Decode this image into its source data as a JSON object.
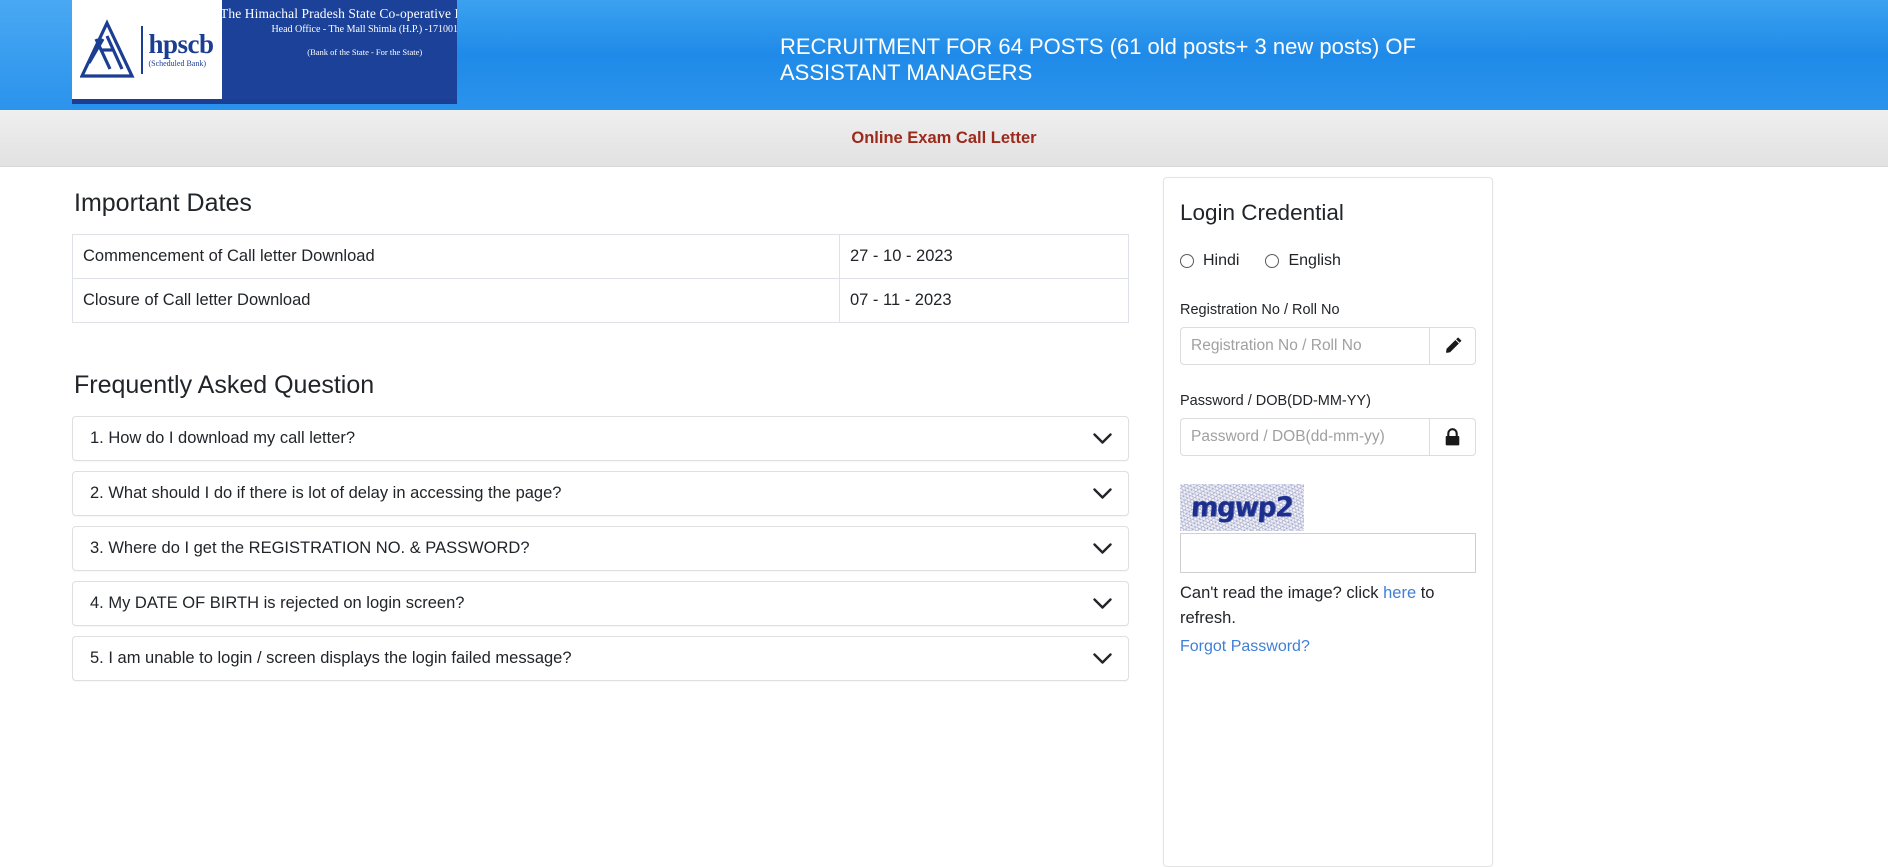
{
  "header": {
    "logo": {
      "brand_short": "hpscb",
      "brand_sub": "(Scheduled Bank)",
      "bank_name": "The Himachal Pradesh State Co-operative Bank Ltd.",
      "office_line": "Head Office - The Mall Shimla (H.P.) -171001",
      "tagline": "(Bank of the State - For the State)"
    },
    "title": "RECRUITMENT FOR 64 POSTS (61 old posts+ 3 new posts) OF ASSISTANT MANAGERS",
    "subheader": "Online Exam Call Letter",
    "subheader_color": "#9c2a1c",
    "banner_color": "#2a93ec",
    "logo_blue": "#1b4298"
  },
  "important_dates": {
    "heading": "Important Dates",
    "rows": [
      {
        "label": "Commencement of Call letter Download",
        "value": "27 - 10 - 2023"
      },
      {
        "label": "Closure of Call letter Download",
        "value": "07 - 11 - 2023"
      }
    ]
  },
  "faq": {
    "heading": "Frequently Asked Question",
    "items": [
      {
        "question": "1. How do I download my call letter?",
        "icon": "chevron-down-icon"
      },
      {
        "question": "2. What should I do if there is lot of delay in accessing the page?",
        "icon": "chevron-down-icon"
      },
      {
        "question": "3. Where do I get the REGISTRATION NO. & PASSWORD?",
        "icon": "chevron-down-icon"
      },
      {
        "question": "4. My DATE OF BIRTH is rejected on login screen?",
        "icon": "chevron-down-icon"
      },
      {
        "question": "5. I am unable to login / screen displays the login failed message?",
        "icon": "chevron-down-icon"
      }
    ]
  },
  "login": {
    "title": "Login Credential",
    "language_options": [
      {
        "label": "Hindi",
        "selected": false
      },
      {
        "label": "English",
        "selected": false
      }
    ],
    "registration": {
      "label": "Registration No / Roll No",
      "placeholder": "Registration No / Roll No",
      "value": "",
      "icon": "pencil-icon"
    },
    "password": {
      "label": "Password / DOB(DD-MM-YY)",
      "placeholder": "Password / DOB(dd-mm-yy)",
      "value": "",
      "icon": "lock-icon"
    },
    "captcha": {
      "image_text": "mgwp2",
      "input_value": "",
      "input_placeholder": "",
      "refresh_prefix": "Can't read the image? click ",
      "refresh_link": "here",
      "refresh_suffix": " to refresh.",
      "text_color": "#1d2f8e"
    },
    "forgot_password": "Forgot Password?",
    "link_color": "#3f7fd4"
  }
}
